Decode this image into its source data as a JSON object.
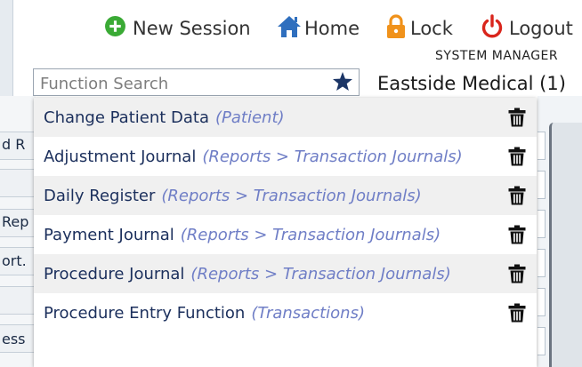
{
  "header": {
    "new_session": "New Session",
    "home": "Home",
    "lock": "Lock",
    "logout": "Logout",
    "user": "SYSTEM MANAGER",
    "facility": "Eastside Medical (1)"
  },
  "search": {
    "placeholder": "Function Search",
    "value": ""
  },
  "background_fragments": [
    "d R",
    "Rep",
    "ort.",
    "ess"
  ],
  "results": [
    {
      "name": "Change Patient Data",
      "path": "(Patient)"
    },
    {
      "name": "Adjustment Journal",
      "path": "(Reports > Transaction Journals)"
    },
    {
      "name": "Daily Register",
      "path": "(Reports > Transaction Journals)"
    },
    {
      "name": "Payment Journal",
      "path": "(Reports > Transaction Journals)"
    },
    {
      "name": "Procedure Journal",
      "path": "(Reports > Transaction Journals)"
    },
    {
      "name": "Procedure Entry Function",
      "path": "(Transactions)"
    }
  ],
  "colors": {
    "new_session_icon": "#3aaa35",
    "home_icon": "#2f6fbe",
    "lock_icon": "#f0921b",
    "logout_icon": "#d9251c",
    "star": "#1b3566",
    "result_text": "#1b2f5c",
    "path_text": "#6f7ec6"
  },
  "icons": {
    "new_session": "plus-circle-icon",
    "home": "home-icon",
    "lock": "lock-icon",
    "logout": "power-icon",
    "favorite": "star-icon",
    "delete": "trash-icon"
  }
}
